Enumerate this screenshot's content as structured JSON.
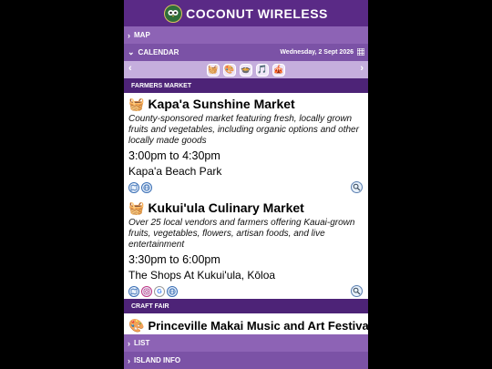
{
  "header": {
    "title": "COCONUT WIRELESS",
    "logo_icon": "owl-logo-icon"
  },
  "nav": {
    "map_label": "MAP",
    "calendar_label": "CALENDAR",
    "calendar_date": "Wednesday, 2 Sept 2026",
    "list_label": "LIST",
    "island_info_label": "ISLAND INFO"
  },
  "category_strip": {
    "prev": "‹",
    "next": "›",
    "icons": [
      {
        "name": "basket-category-icon",
        "glyph": "🧺"
      },
      {
        "name": "palette-category-icon",
        "glyph": "🎨"
      },
      {
        "name": "food-category-icon",
        "glyph": "🍲"
      },
      {
        "name": "music-category-icon",
        "glyph": "🎵"
      },
      {
        "name": "festival-category-icon",
        "glyph": "🎪"
      }
    ]
  },
  "sections": {
    "farmers": "FARMERS MARKET",
    "craft": "CRAFT FAIR"
  },
  "events": [
    {
      "emoji": "🧺",
      "title": "Kapa'a Sunshine Market",
      "description": "County-sponsored market featuring fresh, locally grown fruits and vegetables, including organic options and other locally made goods",
      "time": "3:00pm to 4:30pm",
      "location": "Kapa'a Beach Park",
      "links": [
        "map-link-icon",
        "website-link-icon"
      ]
    },
    {
      "emoji": "🧺",
      "title": "Kukui'ula Culinary Market",
      "description": "Over 25 local vendors and farmers offering Kauai-grown fruits, vegetables, flowers, artisan foods, and live entertainment",
      "time": "3:30pm to 6:00pm",
      "location": "The Shops At Kukui'ula, Kōloa",
      "links": [
        "map-link-icon",
        "instagram-link-icon",
        "google-link-icon",
        "website-link-icon"
      ]
    },
    {
      "emoji": "🎨",
      "title": "Princeville Makai Music and Art Festival"
    }
  ],
  "colors": {
    "header": "#5a2a86",
    "nav_bar": "#8d63b5",
    "section_bar": "#4d2377",
    "icon_strip": "#c5aedd"
  }
}
